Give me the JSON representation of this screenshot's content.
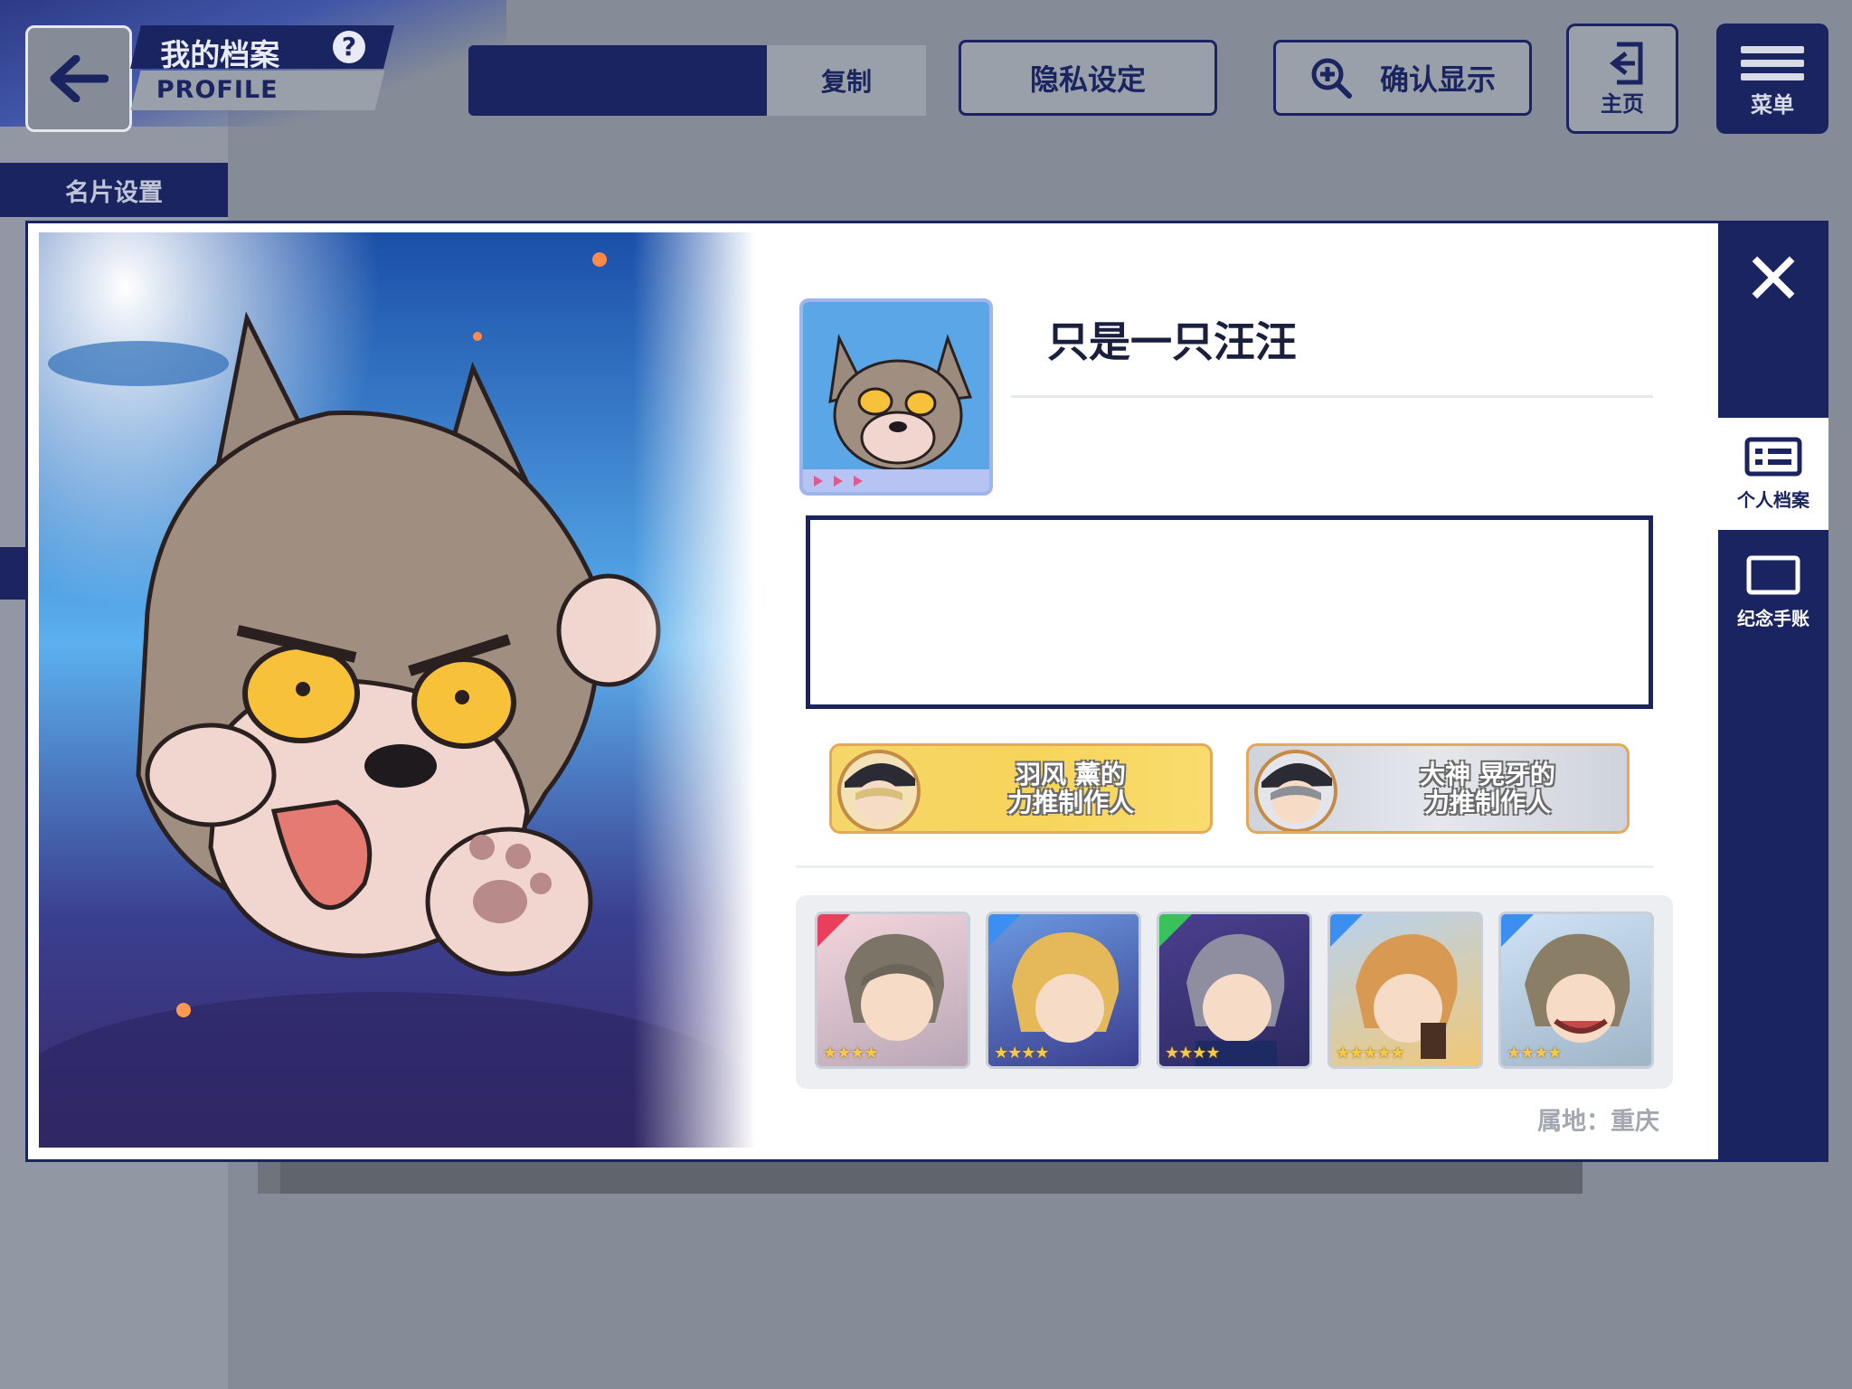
{
  "header": {
    "title_cn": "我的档案",
    "title_en": "PROFILE",
    "help_glyph": "?",
    "copy_label": "复制",
    "privacy_label": "隐私设定",
    "confirm_display_label": "确认显示",
    "home_label": "主页",
    "menu_label": "菜单"
  },
  "sidebar": {
    "card_setting_label": "名片设置"
  },
  "profile": {
    "username": "只是一只汪汪",
    "bio": "",
    "badges": [
      {
        "line1": "羽风 薰的",
        "line2": "力推制作人",
        "style": "gold"
      },
      {
        "line1": "大神 晃牙的",
        "line2": "力推制作人",
        "style": "silver"
      }
    ],
    "cards": [
      {
        "attr_color": "#e8405c",
        "stars": "★★★★"
      },
      {
        "attr_color": "#3c8ff0",
        "stars": "★★★★"
      },
      {
        "attr_color": "#39c25b",
        "stars": "★★★★"
      },
      {
        "attr_color": "#3c8ff0",
        "stars": "★★★★★"
      },
      {
        "attr_color": "#3c8ff0",
        "stars": "★★★★"
      }
    ],
    "location": "属地：重庆"
  },
  "side_nav": {
    "close_glyph": "✕",
    "profile_label": "个人档案",
    "album_label": "纪念手账"
  },
  "colors": {
    "navy": "#1a2460",
    "gold": "#f7d45a",
    "silver": "#dfe2e8"
  }
}
